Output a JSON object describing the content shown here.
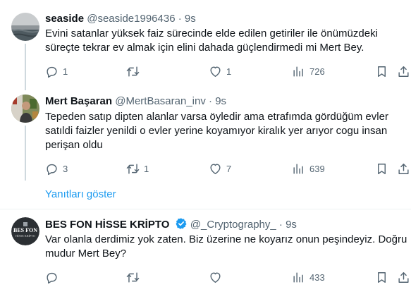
{
  "tweets": [
    {
      "name": "seaside",
      "handle": "@seaside1996436",
      "dot": "·",
      "time": "9s",
      "text_lines": [
        "Evini satanlar yüksek faiz sürecinde elde edilen getiriler ile önümüzdeki",
        "süreçte tekrar ev almak için elini dahada güçlendirmedi mi Mert Bey."
      ],
      "replies": "1",
      "retweets": "",
      "likes": "1",
      "views": "726"
    },
    {
      "name": "Mert Başaran",
      "handle": "@MertBasaran_inv",
      "dot": "·",
      "time": "9s",
      "text_lines": [
        "Tepeden satıp dipten alanlar varsa öyledir ama etrafımda gördüğüm evler",
        "satıldi faizler yenildi o evler yerine koyamıyor kiralık yer arıyor cogu insan",
        "perişan oldu"
      ],
      "replies": "3",
      "retweets": "1",
      "likes": "7",
      "views": "639"
    },
    {
      "name": "BES FON HİSSE KRİPTO",
      "handle": "@_Cryptography_",
      "dot": "·",
      "time": "9s",
      "text_lines": [
        "Var olanla derdimiz yok zaten. Biz üzerine ne koyarız onun peşindeyiz. Doğru",
        "mudur Mert Bey?"
      ],
      "replies": "",
      "retweets": "",
      "likes": "",
      "views": "433",
      "avatar_text_1": "BES FON",
      "avatar_text_2": "HİSSE KRİPTO"
    }
  ],
  "show_replies_label": "Yanıtları göster",
  "colors": {
    "link": "#1d9bf0",
    "muted": "#536471",
    "line": "#cfd9de",
    "divider": "#eff3f4",
    "verified": "#1d9bf0"
  },
  "icons": [
    "reply-icon",
    "retweet-icon",
    "like-icon",
    "views-icon",
    "bookmark-icon",
    "share-icon",
    "verified-badge-icon"
  ]
}
